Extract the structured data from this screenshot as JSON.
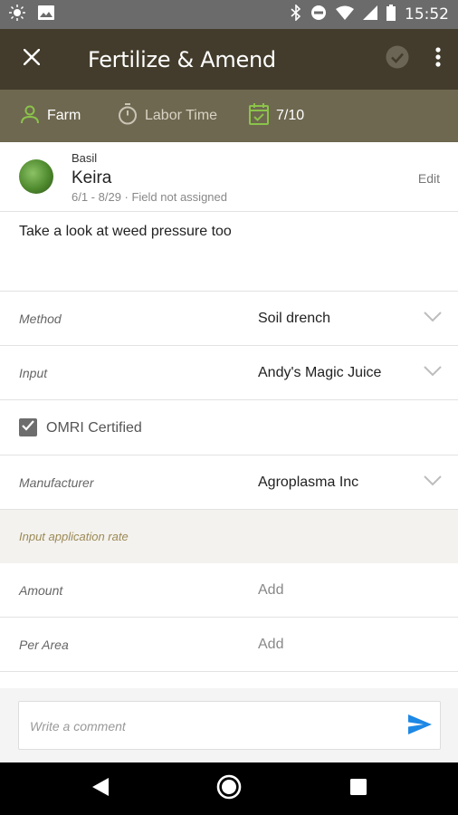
{
  "status_bar": {
    "time": "15:52"
  },
  "app_bar": {
    "title": "Fertilize & Amend"
  },
  "sub_bar": {
    "farm_label": "Farm",
    "labor_label": "Labor Time",
    "date_label": "7/10"
  },
  "crop": {
    "type": "Basil",
    "name": "Keira",
    "dates": "6/1 - 8/29 · Field not assigned",
    "edit_label": "Edit"
  },
  "notes": "Take a look at weed pressure too",
  "fields": {
    "method": {
      "label": "Method",
      "value": "Soil drench"
    },
    "input": {
      "label": "Input",
      "value": "Andy's Magic Juice"
    },
    "omri": {
      "label": "OMRI Certified",
      "checked": true
    },
    "manufacturer": {
      "label": "Manufacturer",
      "value": "Agroplasma Inc"
    }
  },
  "application_rate": {
    "header": "Input application rate",
    "amount": {
      "label": "Amount",
      "value": "Add"
    },
    "per_area": {
      "label": "Per Area",
      "value": "Add"
    }
  },
  "comment": {
    "placeholder": "Write a comment"
  },
  "colors": {
    "app_bar": "#433c2c",
    "sub_bar": "#6e6850",
    "accent_green": "#8bc34a",
    "send_blue": "#1e88e5"
  }
}
